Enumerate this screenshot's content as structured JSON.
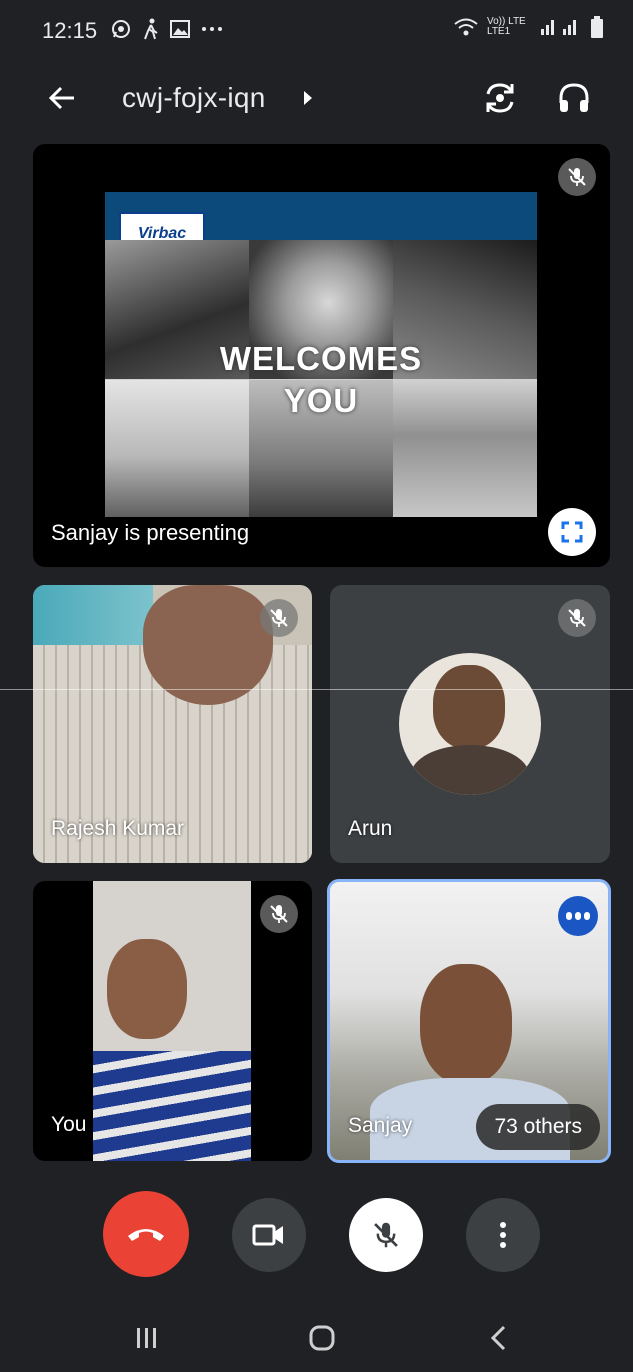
{
  "status_bar": {
    "time": "12:15",
    "carrier_text": "Vo)) LTE LTE1",
    "icons": [
      "whatsapp-icon",
      "walking-icon",
      "gallery-icon",
      "more-dots-icon",
      "wifi-icon",
      "signal-icon",
      "battery-icon"
    ]
  },
  "header": {
    "meeting_code": "cwj-fojx-iqn"
  },
  "presentation": {
    "slide_brand": "Virbac",
    "slide_line1": "WELCOMES",
    "slide_line2": "YOU",
    "label": "Sanjay is presenting"
  },
  "participants": [
    {
      "name": "Rajesh Kumar",
      "muted": true
    },
    {
      "name": "Arun",
      "muted": true
    },
    {
      "name": "You",
      "muted": true
    },
    {
      "name": "Sanjay",
      "speaking": true
    }
  ],
  "others_count_label": "73 others",
  "colors": {
    "background": "#202124",
    "end_call": "#ea4335",
    "speaking_border": "#8ab4f8",
    "speaking_badge": "#1a56c4"
  }
}
